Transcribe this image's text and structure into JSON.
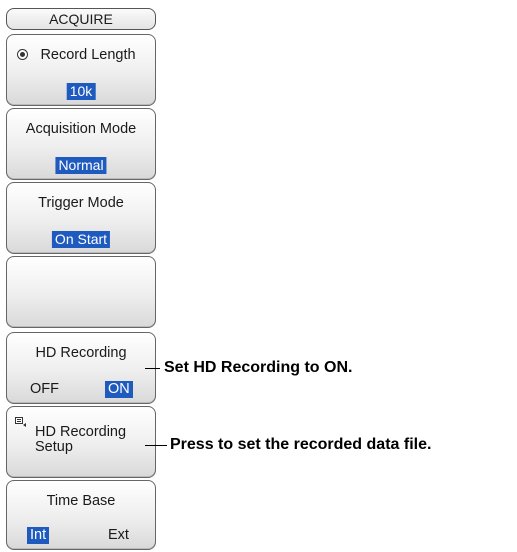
{
  "menu": {
    "title": "ACQUIRE"
  },
  "panels": {
    "record_length": {
      "label": "Record Length",
      "value": "10k",
      "icon": "radio-dial-icon"
    },
    "acquisition_mode": {
      "label": "Acquisition Mode",
      "value": "Normal"
    },
    "trigger_mode": {
      "label": "Trigger Mode",
      "value": "On Start"
    },
    "empty": {},
    "hd_recording": {
      "label": "HD Recording",
      "off_label": "OFF",
      "on_label": "ON",
      "selected": "ON"
    },
    "hd_recording_setup": {
      "label_line1": "HD Recording",
      "label_line2": "Setup",
      "icon": "setup-menu-icon"
    },
    "time_base": {
      "label": "Time Base",
      "int_label": "Int",
      "ext_label": "Ext",
      "selected": "Int"
    }
  },
  "callouts": {
    "hd_recording": "Set HD Recording to ON.",
    "hd_recording_setup": "Press to set the recorded data file."
  },
  "colors": {
    "selected_bg": "#1f5bbf",
    "panel_border": "#666666"
  }
}
